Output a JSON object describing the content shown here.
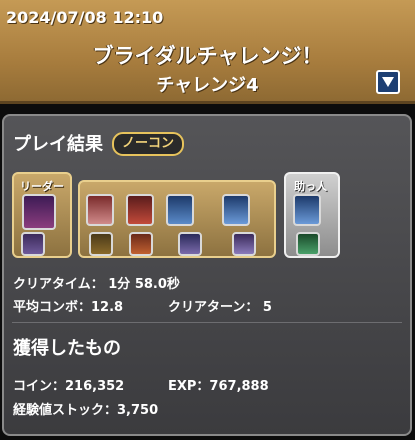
{
  "header": {
    "timestamp": "2024/07/08 12:10",
    "event_title": "ブライダルチャレンジ！",
    "stage": "チャレンジ4",
    "dropdown_icon": "triangle-down-icon"
  },
  "result": {
    "title": "プレイ結果",
    "badge": "ノーコン",
    "leader_label": "リーダー",
    "helper_label": "助っ人",
    "clear_time": "クリアタイム： 1分 58.0秒",
    "avg_combo": "平均コンボ：12.8",
    "clear_turns": "クリアターン： 5"
  },
  "rewards": {
    "title": "獲得したもの",
    "coin": "コイン：216,352",
    "exp": "EXP：767,888",
    "exp_stock": "経験値ストック：3,750"
  },
  "colors": {
    "header_gold": "#a87d3e",
    "badge_gold": "#e7c35c",
    "dropdown_blue": "#1d3f73"
  }
}
